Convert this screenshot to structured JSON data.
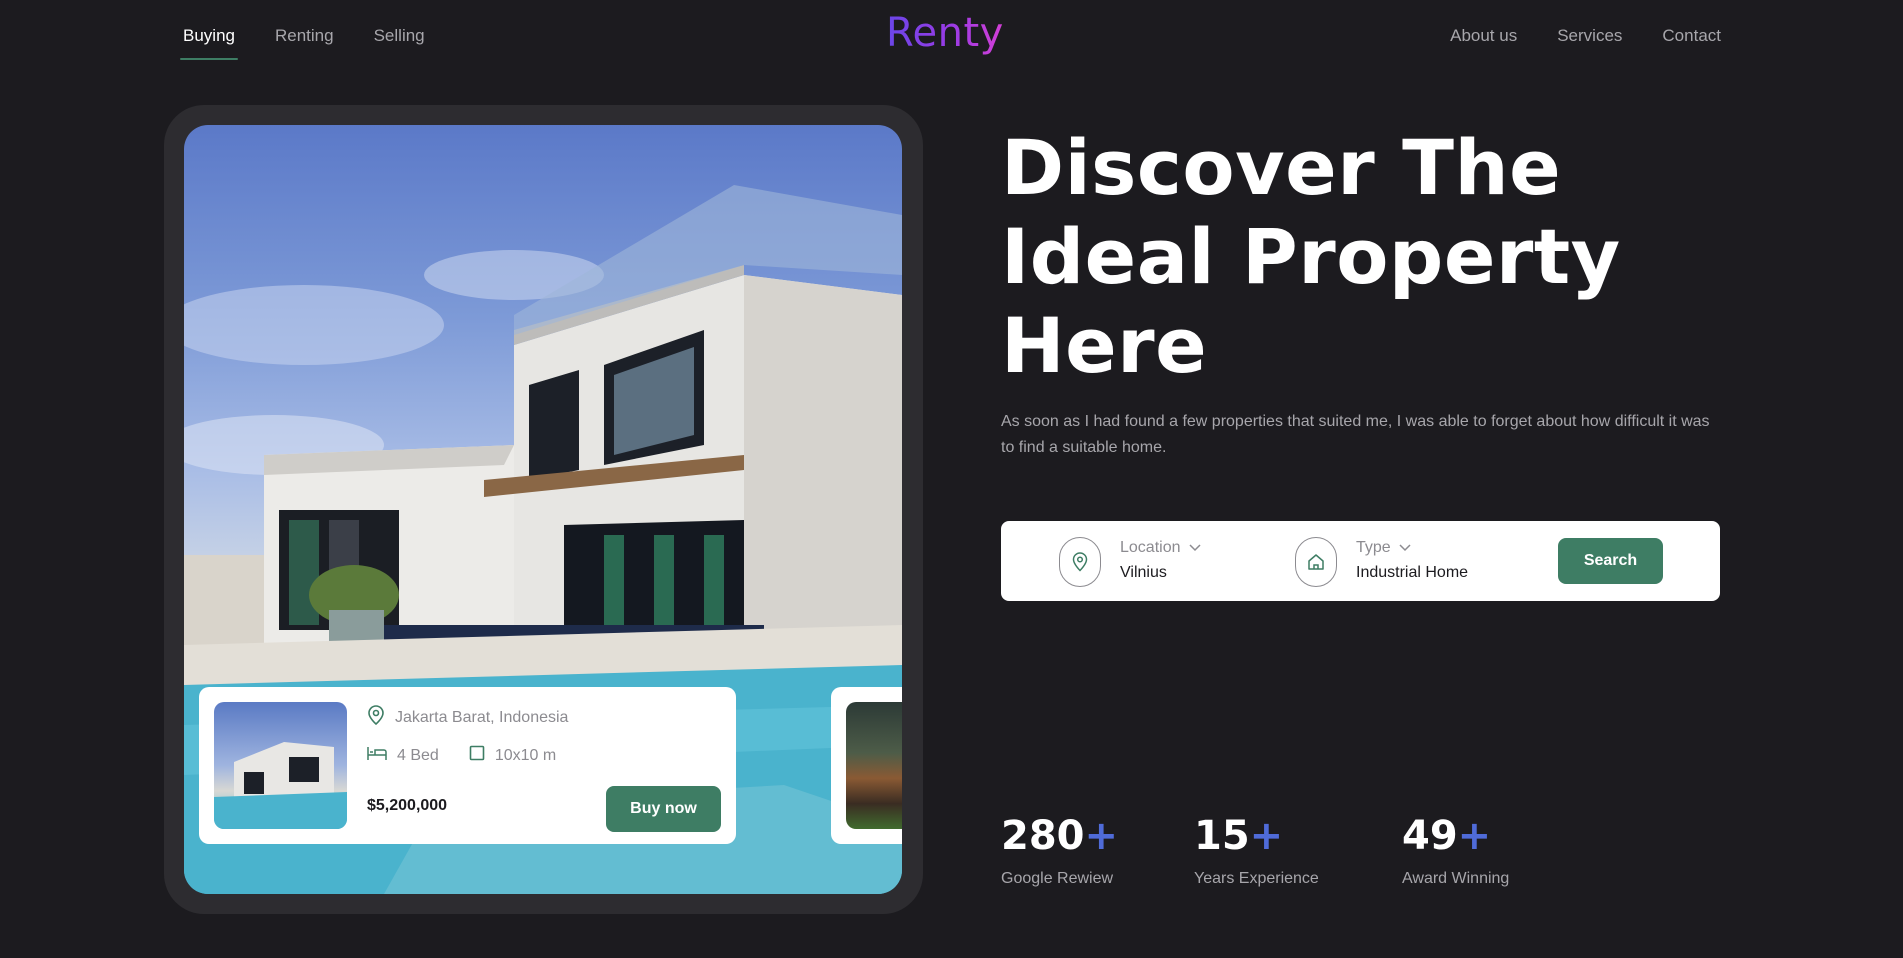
{
  "nav": {
    "left": [
      {
        "label": "Buying",
        "active": true
      },
      {
        "label": "Renting"
      },
      {
        "label": "Selling"
      }
    ],
    "logo": "Renty",
    "right": [
      {
        "label": "About us"
      },
      {
        "label": "Services"
      },
      {
        "label": "Contact"
      }
    ]
  },
  "hero": {
    "title_lines": [
      "Discover The",
      "Ideal Property",
      "Here"
    ],
    "subtitle": "As soon as I had found a few properties that suited me, I was able to forget about how difficult it was to find a suitable home."
  },
  "search": {
    "location_label": "Location",
    "location_value": "Vilnius",
    "type_label": "Type",
    "type_value": "Industrial Home",
    "button": "Search"
  },
  "listing": {
    "location": "Jakarta Barat, Indonesia",
    "beds": "4 Bed",
    "size": "10x10 m",
    "price": "$5,200,000",
    "button": "Buy now"
  },
  "stats": [
    {
      "number": "280",
      "suffix": "+",
      "label": "Google Rewiew"
    },
    {
      "number": "15",
      "suffix": "+",
      "label": "Years Experience"
    },
    {
      "number": "49",
      "suffix": "+",
      "label": "Award Winning"
    }
  ],
  "colors": {
    "background": "#1c1b1f",
    "accent_green": "#3e7d64",
    "accent_blue": "#4f6bd8",
    "logo_gradient": [
      "#6a46e8",
      "#d43fd6"
    ]
  },
  "icons": [
    "location-pin-icon",
    "chevron-down-icon",
    "home-icon",
    "bed-icon",
    "area-square-icon"
  ]
}
